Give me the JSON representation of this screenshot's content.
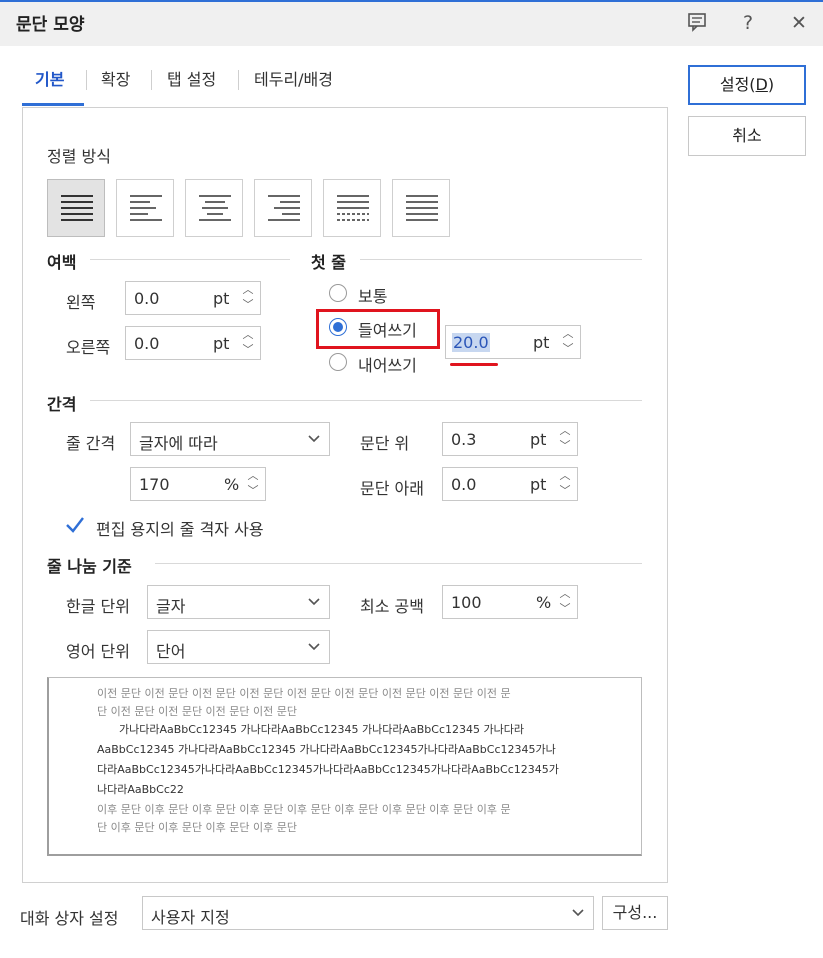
{
  "window": {
    "title": "문단 모양"
  },
  "tabs": [
    {
      "label": "기본"
    },
    {
      "label": "확장"
    },
    {
      "label": "탭 설정"
    },
    {
      "label": "테두리/배경"
    }
  ],
  "buttons": {
    "ok": "설정(",
    "ok_key": "D",
    "ok_end": ")",
    "cancel": "취소"
  },
  "alignment": {
    "title": "정렬 방식",
    "options": [
      "justify",
      "left",
      "center",
      "right",
      "distribute",
      "divide"
    ],
    "selected": "justify"
  },
  "margin": {
    "title": "여백",
    "left": {
      "label": "왼쪽",
      "value": "0.0",
      "unit": "pt"
    },
    "right": {
      "label": "오른쪽",
      "value": "0.0",
      "unit": "pt"
    }
  },
  "first_line": {
    "title": "첫 줄",
    "normal": "보통",
    "indent": "들여쓰기",
    "outdent": "내어쓰기",
    "selected": "indent",
    "value": "20.0",
    "unit": "pt"
  },
  "spacing": {
    "title": "간격",
    "line_label": "줄 간격",
    "line_mode": "글자에 따라",
    "line_value": "170",
    "line_unit": "%",
    "above_label": "문단 위",
    "above_value": "0.3",
    "above_unit": "pt",
    "below_label": "문단 아래",
    "below_value": "0.0",
    "below_unit": "pt",
    "grid_label": "편집 용지의 줄 격자 사용",
    "grid_checked": true
  },
  "line_break": {
    "title": "줄 나눔 기준",
    "korean_label": "한글 단위",
    "korean_value": "글자",
    "english_label": "영어 단위",
    "english_value": "단어",
    "min_space_label": "최소 공백",
    "min_space_value": "100",
    "min_space_unit": "%"
  },
  "preview": {
    "prev_1": "이전 문단 이전 문단 이전 문단 이전 문단 이전 문단 이전 문단 이전 문단 이전 문단 이전 문",
    "prev_2": "단 이전 문단 이전 문단 이전 문단 이전 문단",
    "body_1": "가나다라AaBbCc12345     가나다라AaBbCc12345     가나다라AaBbCc12345     가나다라",
    "body_2": "AaBbCc12345     가나다라AaBbCc12345     가나다라AaBbCc12345가나다라AaBbCc12345가나",
    "body_3": "다라AaBbCc12345가나다라AaBbCc12345가나다라AaBbCc12345가나다라AaBbCc12345가",
    "body_4": "나다라AaBbCc22",
    "next_1": "이후 문단 이후 문단 이후 문단 이후 문단 이후 문단 이후 문단 이후 문단 이후 문단 이후 문",
    "next_2": "단 이후 문단 이후 문단 이후 문단 이후 문단"
  },
  "footer": {
    "label": "대화 상자 설정",
    "value": "사용자 지정",
    "config_button": "구성..."
  },
  "colors": {
    "accent": "#2f6fd6",
    "highlight": "#e0141e"
  }
}
